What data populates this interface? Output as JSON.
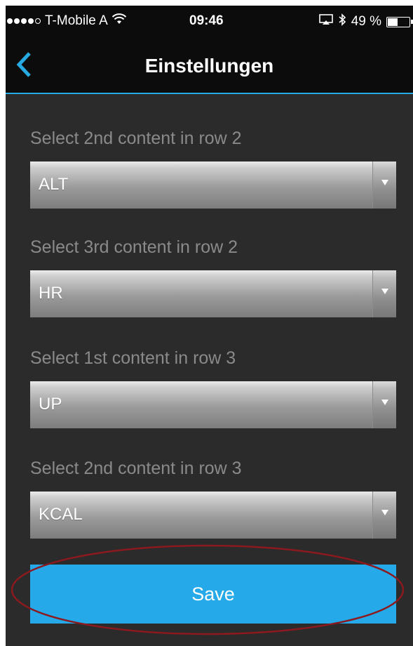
{
  "status_bar": {
    "carrier": "T-Mobile A",
    "time": "09:46",
    "battery_text": "49 %",
    "battery_level": 0.49,
    "signal_bars_filled": 4,
    "signal_bars_total": 5
  },
  "nav": {
    "title": "Einstellungen"
  },
  "fields": [
    {
      "label": "Select 2nd content in row 2",
      "value": "ALT"
    },
    {
      "label": "Select 3rd content in row 2",
      "value": "HR"
    },
    {
      "label": "Select 1st content in row 3",
      "value": "UP"
    },
    {
      "label": "Select 2nd content in row 3",
      "value": "KCAL"
    }
  ],
  "save": {
    "label": "Save"
  },
  "colors": {
    "background": "#2b2b2b",
    "bar": "#0c0c0c",
    "accent": "#27aae1",
    "save_button": "#26a9e8",
    "highlight": "#8b1a1f",
    "label_text": "#8a8a8a"
  },
  "icons": {
    "back": "chevron-left-icon",
    "wifi": "wifi-icon",
    "airplay": "airplay-icon",
    "bluetooth": "bluetooth-icon",
    "battery": "battery-icon",
    "dropdown": "dropdown-arrow-icon"
  }
}
